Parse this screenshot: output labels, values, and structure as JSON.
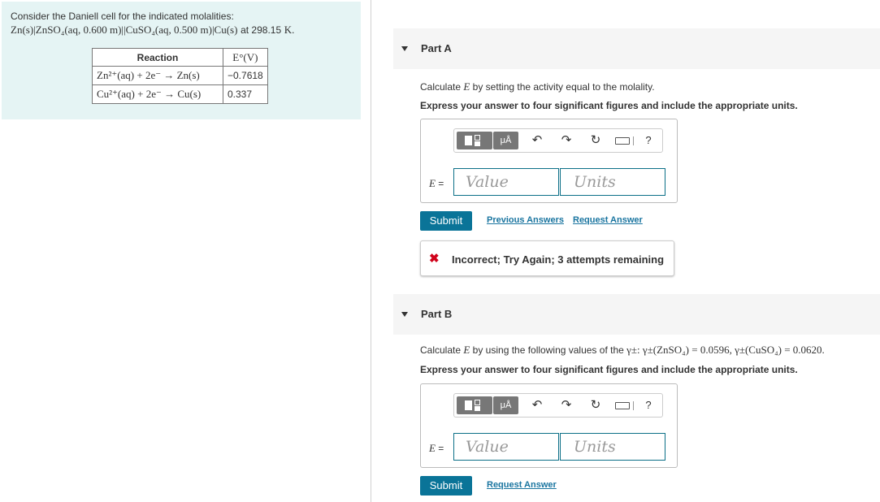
{
  "intro": {
    "line1": "Consider the Daniell cell for the indicated molalities:",
    "cell_notation": "Zn(s)|ZnSO₄(aq, 0.600 m)||CuSO₄(aq, 0.500 m)|Cu(s)",
    "temperature_prefix": "at 298.15",
    "temperature_unit": "K.",
    "table": {
      "headers": [
        "Reaction",
        "E°(V)"
      ],
      "rows": [
        {
          "reaction": "Zn²⁺(aq) + 2e⁻ → Zn(s)",
          "value": "−0.7618"
        },
        {
          "reaction": "Cu²⁺(aq) + 2e⁻ → Cu(s)",
          "value": "0.337"
        }
      ]
    }
  },
  "partA": {
    "title": "Part A",
    "prompt_pre": "Calculate",
    "prompt_var": "E",
    "prompt_post": "by setting the activity equal to the molality.",
    "instruction": "Express your answer to four significant figures and include the appropriate units.",
    "eq_var": "E",
    "eq_sign": " =",
    "value_placeholder": "Value",
    "units_placeholder": "Units",
    "submit_label": "Submit",
    "previous_answers": "Previous Answers",
    "request_answer": "Request Answer",
    "feedback": "Incorrect; Try Again; 3 attempts remaining"
  },
  "partB": {
    "title": "Part B",
    "prompt_pre": "Calculate",
    "prompt_var": "E",
    "prompt_mid": "by using the following values of the",
    "prompt_math": "γ±: γ±(ZnSO₄) = 0.0596, γ±(CuSO₄) = 0.0620.",
    "instruction": "Express your answer to four significant figures and include the appropriate units.",
    "eq_var": "E",
    "eq_sign": " =",
    "value_placeholder": "Value",
    "units_placeholder": "Units",
    "submit_label": "Submit",
    "request_answer": "Request Answer"
  },
  "toolbar": {
    "units_label": "μÅ",
    "undo_icon": "↶",
    "redo_icon": "↷",
    "reset_icon": "↻",
    "help_label": "?"
  },
  "colors": {
    "intro_bg": "#e5f4f4",
    "submit_bg": "#0a7498",
    "link": "#1a75a0",
    "error": "#d0021b",
    "input_border": "#0b6f87"
  }
}
